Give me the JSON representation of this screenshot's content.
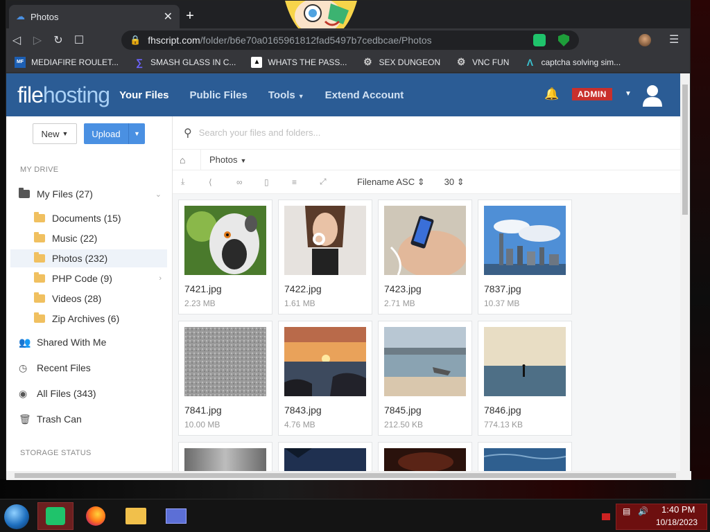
{
  "browser": {
    "tab_title": "Photos",
    "url_host": "fhscript.com",
    "url_path": "/folder/b6e70a0165961812fad5497b7cedbcae/Photos"
  },
  "bookmarks": [
    {
      "label": "MEDIAFIRE ROULET...",
      "icon": "mediafire-icon"
    },
    {
      "label": "SMASH GLASS IN C...",
      "icon": "smashglass-icon"
    },
    {
      "label": "WHATS THE PASS...",
      "icon": "whatsthepass-icon"
    },
    {
      "label": "SEX DUNGEON",
      "icon": "gear-icon"
    },
    {
      "label": "VNC FUN",
      "icon": "gear-icon"
    },
    {
      "label": "captcha solving sim...",
      "icon": "captcha-icon"
    }
  ],
  "header": {
    "logo_file": "file",
    "logo_hosting": "hosting",
    "nav": [
      "Your Files",
      "Public Files",
      "Tools",
      "Extend Account"
    ],
    "admin_label": "ADMIN"
  },
  "sidebar": {
    "new_label": "New",
    "upload_label": "Upload",
    "my_drive_heading": "MY DRIVE",
    "my_files": "My Files (27)",
    "folders": [
      "Documents (15)",
      "Music (22)",
      "Photos (232)",
      "PHP Code (9)",
      "Videos (28)",
      "Zip Archives (6)"
    ],
    "shared": "Shared With Me",
    "recent": "Recent Files",
    "all_files": "All Files (343)",
    "trash": "Trash Can",
    "storage_heading": "STORAGE STATUS"
  },
  "main": {
    "search_placeholder": "Search your files and folders...",
    "breadcrumb": "Photos",
    "sort_label": "Filename ASC",
    "per_page": "30"
  },
  "files": [
    {
      "name": "7421.jpg",
      "size": "2.23 MB"
    },
    {
      "name": "7422.jpg",
      "size": "1.61 MB"
    },
    {
      "name": "7423.jpg",
      "size": "2.71 MB"
    },
    {
      "name": "7837.jpg",
      "size": "10.37 MB"
    },
    {
      "name": "7841.jpg",
      "size": "10.00 MB"
    },
    {
      "name": "7843.jpg",
      "size": "4.76 MB"
    },
    {
      "name": "7845.jpg",
      "size": "212.50 KB"
    },
    {
      "name": "7846.jpg",
      "size": "774.13 KB"
    }
  ],
  "taskbar": {
    "time": "1:40 PM",
    "date": "10/18/2023"
  },
  "colors": {
    "header_blue": "#2b5c95",
    "upload_blue": "#4a90e2",
    "admin_red": "#c9302c"
  }
}
